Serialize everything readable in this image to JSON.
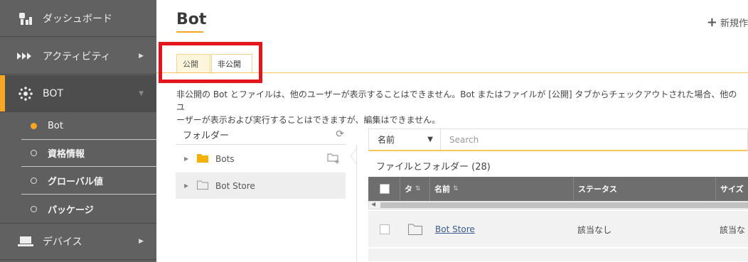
{
  "sidebar": {
    "items": [
      {
        "label": "ダッシュボード",
        "icon": "dashboard-icon"
      },
      {
        "label": "アクティビティ",
        "icon": "activity-icon"
      },
      {
        "label": "BOT",
        "icon": "bot-icon"
      },
      {
        "label": "デバイス",
        "icon": "device-icon"
      }
    ],
    "sub_items": [
      {
        "label": "Bot"
      },
      {
        "label": "資格情報"
      },
      {
        "label": "グローバル値"
      },
      {
        "label": "パッケージ"
      }
    ]
  },
  "header": {
    "title": "Bot",
    "new_label": "新規作"
  },
  "tabs": [
    {
      "label": "公開"
    },
    {
      "label": "非公開"
    }
  ],
  "info_text_line1": "非公開の Bot とファイルは、他のユーザーが表示することはできません。Bot またはファイルが [公開] タブからチェックアウトされた場合、他のユ",
  "info_text_line2": "ーザーが表示および実行することはできますが、編集はできません。",
  "folders": {
    "header": "フォルダー",
    "items": [
      {
        "label": "Bots"
      },
      {
        "label": "Bot Store"
      }
    ]
  },
  "filter": {
    "field": "名前",
    "placeholder": "Search"
  },
  "files": {
    "count_label": "ファイルとフォルダー (28)",
    "columns": [
      "タ",
      "名前",
      "ステータス",
      "サイズ"
    ],
    "rows": [
      {
        "name": "Bot Store",
        "status": "該当なし",
        "size": "該当な"
      }
    ]
  },
  "colors": {
    "accent": "#f5a623",
    "sidebar": "#5f5f5f",
    "highlight": "#e3161c"
  }
}
